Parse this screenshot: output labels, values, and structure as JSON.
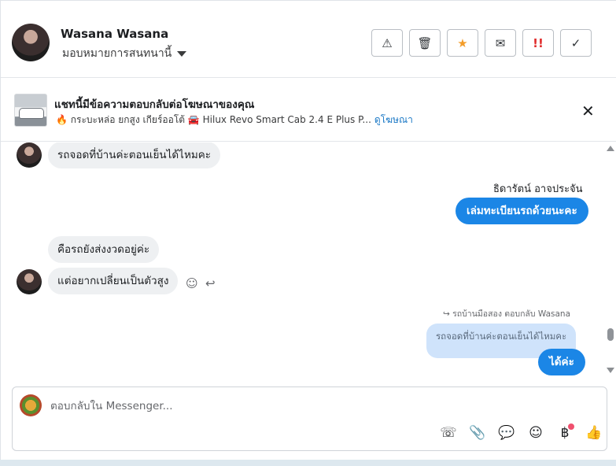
{
  "header": {
    "contact_name": "Wasana Wasana",
    "assign_label": "มอบหมายการสนทนานี้",
    "actions": [
      {
        "name": "mark-spam-button",
        "icon": "warning-icon",
        "glyph": "⚠"
      },
      {
        "name": "delete-button",
        "icon": "trash-icon",
        "glyph": "🗑"
      },
      {
        "name": "star-button",
        "icon": "star-icon",
        "glyph": "★"
      },
      {
        "name": "mark-unread-button",
        "icon": "envelope-icon",
        "glyph": "✉"
      },
      {
        "name": "priority-button",
        "icon": "double-exclamation-icon",
        "glyph": "!!"
      },
      {
        "name": "done-button",
        "icon": "check-icon",
        "glyph": "✓"
      }
    ]
  },
  "ad_banner": {
    "title": "แชทนี้มีข้อความตอบกลับต่อโฆษณาของคุณ",
    "subtitle": "🔥 กระบะหล่อ ยกสูง เกียร์ออโต้ 🚘 Hilux Revo Smart Cab 2.4 E Plus P...",
    "link_label": "ดูโฆษณา",
    "close_glyph": "✕"
  },
  "messages": {
    "m1": "รถจอดที่บ้านค่ะตอนเย็นได้ไหมคะ",
    "m2_sender": "ธิดารัตน์ อาจประจัน",
    "m2": "เล่มทะเบียนรถด้วยนะคะ",
    "m3": "คือรถยังส่งงวดอยู่ค่ะ",
    "m4": "แต่อยากเปลี่ยนเป็นตัวสูง",
    "m5_reply_note": "รถบ้านมือสอง ตอบกลับ Wasana",
    "m5_quoted": "รถจอดที่บ้านค่ะตอนเย็นได้ไหมคะ",
    "m5": "ได้ค่ะ"
  },
  "composer": {
    "placeholder": "ตอบกลับใน Messenger...",
    "tools": [
      {
        "name": "call-icon",
        "glyph": "☏"
      },
      {
        "name": "attachment-icon",
        "glyph": "📎"
      },
      {
        "name": "saved-reply-icon",
        "glyph": "💬"
      },
      {
        "name": "emoji-icon",
        "glyph": "☺"
      },
      {
        "name": "payment-icon",
        "glyph": "฿"
      },
      {
        "name": "like-icon",
        "glyph": "👍"
      }
    ]
  },
  "colors": {
    "accent": "#1b86e6",
    "star": "#f39c29",
    "urgent": "#e02c2c"
  }
}
